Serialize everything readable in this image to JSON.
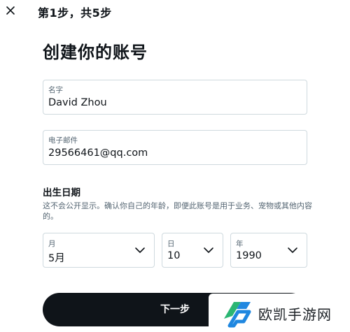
{
  "header": {
    "close_icon": "close-icon",
    "step_text": "第1步，共5步"
  },
  "page": {
    "title": "创建你的账号"
  },
  "form": {
    "name": {
      "label": "名字",
      "value": "David Zhou"
    },
    "email": {
      "label": "电子邮件",
      "value": "29566461@qq.com"
    }
  },
  "dob": {
    "heading": "出生日期",
    "description": "这不会公开显示。确认你自己的年龄，即便此账号是用于业务、宠物或其他内容的。",
    "month": {
      "label": "月",
      "value": "5月"
    },
    "day": {
      "label": "日",
      "value": "10"
    },
    "year": {
      "label": "年",
      "value": "1990"
    }
  },
  "actions": {
    "next_label": "下一步"
  },
  "watermark": {
    "text": "欧凯手游网",
    "logo_icon": "okhsy-logo-icon",
    "colors": {
      "green": "#2bb673",
      "blue": "#1f87e0"
    }
  },
  "colors": {
    "button_bg": "#0f1419",
    "border": "#cfd9de",
    "secondary_text": "#536471"
  }
}
